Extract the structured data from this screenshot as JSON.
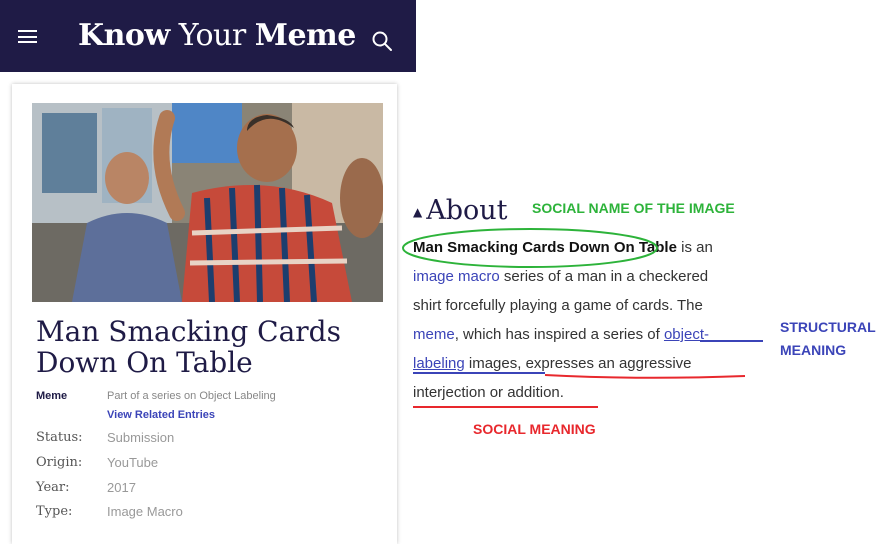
{
  "header": {
    "logo_know": "Know",
    "logo_your": "Your",
    "logo_meme": "Meme",
    "menu_icon": "hamburger-icon",
    "search_icon": "search-icon",
    "bg_color": "#1f1b46"
  },
  "card": {
    "title": "Man Smacking Cards Down On Table",
    "category_label": "Meme",
    "series_text": "Part of a series on Object Labeling",
    "related_link": "View Related Entries",
    "details": [
      {
        "key": "Status:",
        "value": "Submission"
      },
      {
        "key": "Origin:",
        "value": "YouTube"
      },
      {
        "key": "Year:",
        "value": "2017"
      },
      {
        "key": "Type:",
        "value": "Image Macro"
      }
    ]
  },
  "about": {
    "heading": "About",
    "line1_bold": "Man Smacking Cards Down On Table",
    "line1_rest": " is an",
    "line2_link": "image macro",
    "line2_rest": " series of a man in a checkered",
    "line3": "shirt forcefully playing a game of cards. The",
    "line4_link": "meme",
    "line4_mid": ", which has inspired a series of ",
    "line4_link2": "object-",
    "line5_link": "labeling",
    "line5_rest": " images, expresses an aggressive",
    "line6": "interjection or addition."
  },
  "annotations": {
    "social_name": "SOCIAL NAME OF THE IMAGE",
    "structural_line1": "STRUCTURAL",
    "structural_line2": "MEANING",
    "social_meaning": "SOCIAL MEANING",
    "green": "#2db33a",
    "blue": "#3b44b8",
    "red": "#e8282d"
  }
}
